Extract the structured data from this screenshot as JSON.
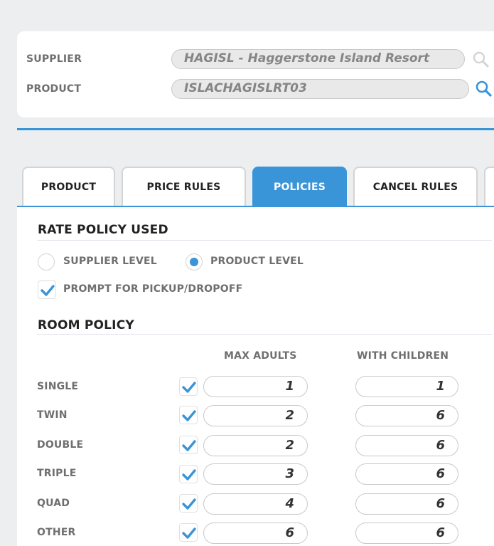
{
  "supplier": {
    "label": "SUPPLIER",
    "value": "HAGISL - Haggerstone Island Resort"
  },
  "product": {
    "label": "PRODUCT",
    "value": "ISLACHAGISLRT03"
  },
  "tabs": [
    {
      "label": "PRODUCT",
      "active": false
    },
    {
      "label": "PRICE RULES",
      "active": false
    },
    {
      "label": "POLICIES",
      "active": true
    },
    {
      "label": "CANCEL RULES",
      "active": false
    }
  ],
  "rate_policy": {
    "title": "RATE POLICY USED",
    "options": [
      {
        "label": "SUPPLIER LEVEL",
        "selected": false
      },
      {
        "label": "PRODUCT LEVEL",
        "selected": true
      }
    ],
    "prompt_label": "PROMPT FOR PICKUP/DROPOFF",
    "prompt_checked": true
  },
  "room_policy": {
    "title": "ROOM POLICY",
    "col_max_adults": "MAX ADULTS",
    "col_with_children": "WITH CHILDREN",
    "rows": [
      {
        "label": "SINGLE",
        "checked": true,
        "max_adults": "1",
        "with_children": "1"
      },
      {
        "label": "TWIN",
        "checked": true,
        "max_adults": "2",
        "with_children": "6"
      },
      {
        "label": "DOUBLE",
        "checked": true,
        "max_adults": "2",
        "with_children": "6"
      },
      {
        "label": "TRIPLE",
        "checked": true,
        "max_adults": "3",
        "with_children": "6"
      },
      {
        "label": "QUAD",
        "checked": true,
        "max_adults": "4",
        "with_children": "6"
      },
      {
        "label": "OTHER",
        "checked": true,
        "max_adults": "6",
        "with_children": "6"
      }
    ]
  },
  "colors": {
    "accent": "#3a94d8",
    "icon_disabled": "#d4d4d4"
  }
}
